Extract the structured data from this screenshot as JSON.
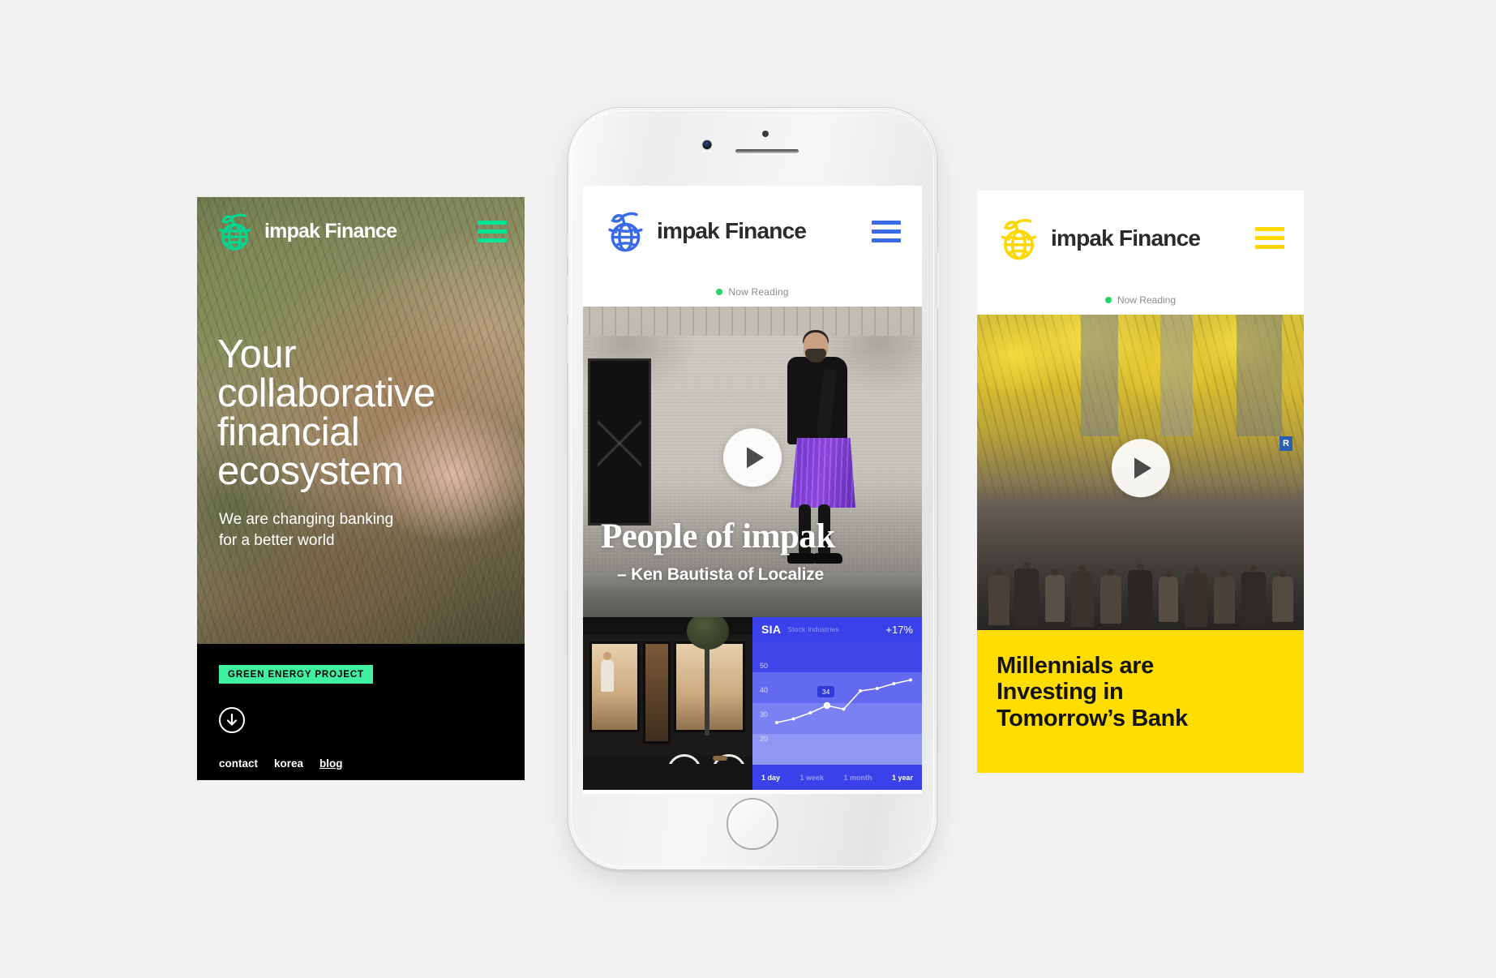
{
  "brand": {
    "name": "impak Finance",
    "colors": {
      "green": "#00d68f",
      "blue": "#3b6ae8",
      "yellow": "#ffdd00",
      "mint": "#3ff0a0",
      "chart_blue": "#3b41e8",
      "now_reading_dot": "#22d46b"
    }
  },
  "left_screen": {
    "logo_name": "impak-globe-leaf-logo",
    "brand_name": "impak Finance",
    "menu_icon": "hamburger-menu-icon",
    "headline": "Your collaborative financial ecosystem",
    "headline_lines": [
      "Your",
      "collaborative",
      "financial",
      "ecosystem"
    ],
    "subhead_lines": [
      "We are changing banking",
      "for a better world"
    ],
    "badge": "GREEN ENERGY PROJECT",
    "scroll_icon": "arrow-down-icon",
    "links": [
      {
        "label": "contact",
        "underline": false
      },
      {
        "label": "korea",
        "underline": false
      },
      {
        "label": "blog",
        "underline": true
      }
    ]
  },
  "middle_phone": {
    "device": "white-iphone-frame",
    "header": {
      "logo_name": "impak-globe-leaf-logo",
      "brand_name": "impak Finance",
      "menu_icon": "hamburger-menu-icon"
    },
    "now_reading": "Now Reading",
    "hero": {
      "play_icon": "play-button-icon",
      "title": "People of impak",
      "subtitle": "– Ken Bautista of Localize"
    },
    "thumbnail": {
      "name": "storefront-photo-thumbnail"
    },
    "chart_card": {
      "symbol": "SIA",
      "company": "Stock Industries",
      "change": "+17%",
      "tooltip_value": "34",
      "ranges": [
        {
          "label": "1 day",
          "active": true
        },
        {
          "label": "1 week",
          "active": false
        },
        {
          "label": "1 month",
          "active": false
        },
        {
          "label": "1 year",
          "active": true
        }
      ]
    }
  },
  "right_screen": {
    "header": {
      "logo_name": "impak-globe-leaf-logo",
      "brand_name": "impak Finance",
      "menu_icon": "hamburger-menu-icon"
    },
    "now_reading": "Now Reading",
    "hero": {
      "play_icon": "play-button-icon",
      "street_sign": "R"
    },
    "headline_lines": [
      "Millennials are",
      "Investing in",
      "Tomorrow’s Bank"
    ]
  },
  "chart_data": {
    "type": "line",
    "title": "SIA",
    "subtitle": "Stock Industries",
    "annotation": "+17%",
    "xlabel": "",
    "ylabel": "",
    "ylim": [
      15,
      55
    ],
    "yticks": [
      20,
      30,
      40,
      50
    ],
    "grid": true,
    "legend": "none",
    "x": [
      0,
      1,
      2,
      3,
      4,
      5,
      6,
      7,
      8
    ],
    "values": [
      27,
      28.5,
      31,
      34,
      32.5,
      40,
      41,
      43,
      44.5
    ],
    "highlight_point": {
      "x": 3,
      "y": 34,
      "label": "34"
    },
    "range_tabs": [
      "1 day",
      "1 week",
      "1 month",
      "1 year"
    ]
  }
}
